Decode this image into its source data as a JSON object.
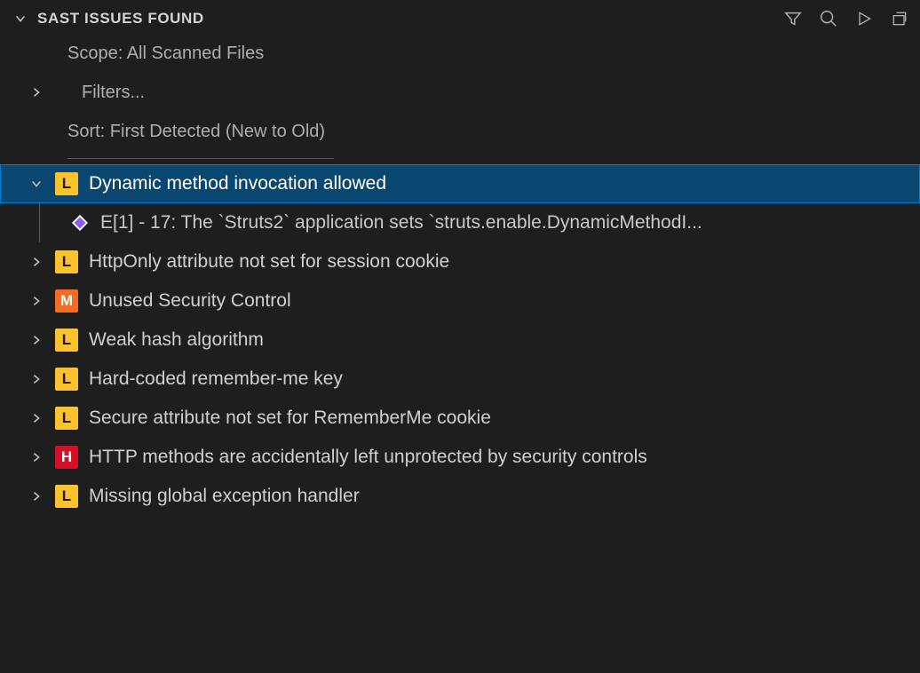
{
  "panel": {
    "title": "SAST ISSUES FOUND"
  },
  "meta": {
    "scope": "Scope: All Scanned Files",
    "filters": "Filters...",
    "sort": "Sort: First Detected (New to Old)"
  },
  "issues": [
    {
      "severity": "L",
      "label": "Dynamic method invocation allowed",
      "expanded": true,
      "selected": true,
      "detail": "E[1] - 17: The `Struts2` application sets `struts.enable.DynamicMethodI..."
    },
    {
      "severity": "L",
      "label": "HttpOnly attribute not set for session cookie",
      "expanded": false
    },
    {
      "severity": "M",
      "label": "Unused Security Control",
      "expanded": false
    },
    {
      "severity": "L",
      "label": "Weak hash algorithm",
      "expanded": false
    },
    {
      "severity": "L",
      "label": "Hard-coded remember-me key",
      "expanded": false
    },
    {
      "severity": "L",
      "label": "Secure attribute not set for RememberMe cookie",
      "expanded": false
    },
    {
      "severity": "H",
      "label": "HTTP methods are accidentally left unprotected by security controls",
      "expanded": false
    },
    {
      "severity": "L",
      "label": "Missing global exception handler",
      "expanded": false
    }
  ]
}
